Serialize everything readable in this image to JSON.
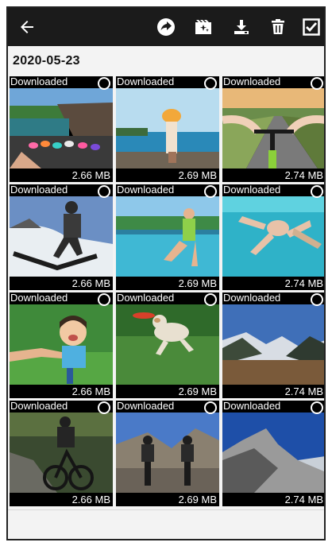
{
  "toolbar": {
    "back_icon": "back-arrow-icon",
    "share_icon": "share-icon",
    "effects_icon": "movie-magic-icon",
    "download_icon": "download-icon",
    "delete_icon": "trash-icon",
    "select_all_icon": "checkbox-icon"
  },
  "gallery": {
    "date": "2020-05-23",
    "items": [
      {
        "status": "Downloaded",
        "size": "2.66 MB"
      },
      {
        "status": "Downloaded",
        "size": "2.69 MB"
      },
      {
        "status": "Downloaded",
        "size": "2.74 MB"
      },
      {
        "status": "Downloaded",
        "size": "2.66 MB"
      },
      {
        "status": "Downloaded",
        "size": "2.69 MB"
      },
      {
        "status": "Downloaded",
        "size": "2.74 MB"
      },
      {
        "status": "Downloaded",
        "size": "2.66 MB"
      },
      {
        "status": "Downloaded",
        "size": "2.69 MB"
      },
      {
        "status": "Downloaded",
        "size": "2.74 MB"
      },
      {
        "status": "Downloaded",
        "size": "2.66 MB"
      },
      {
        "status": "Downloaded",
        "size": "2.69 MB"
      },
      {
        "status": "Downloaded",
        "size": "2.74 MB"
      }
    ]
  },
  "colors": {
    "toolbar_bg": "#1b1b1b",
    "tile_bg": "#000000",
    "page_bg": "#f3f3f3"
  }
}
